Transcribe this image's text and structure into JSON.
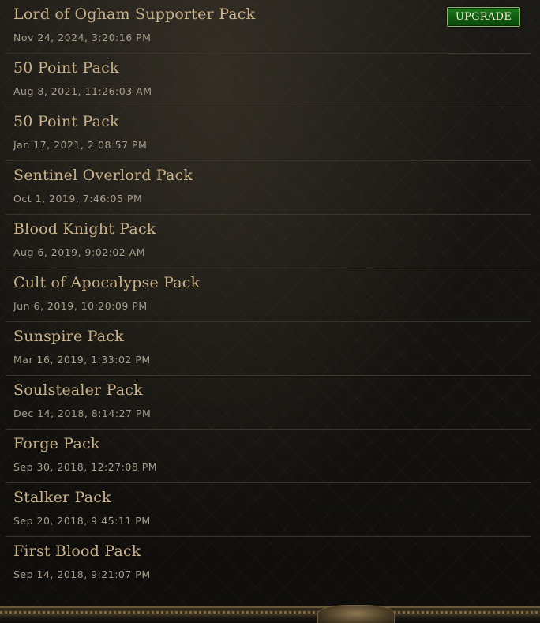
{
  "packs": [
    {
      "name": "Lord of Ogham Supporter Pack",
      "date": "Nov 24, 2024, 3:20:16 PM"
    },
    {
      "name": "50 Point Pack",
      "date": "Aug 8, 2021, 11:26:03 AM"
    },
    {
      "name": "50 Point Pack",
      "date": "Jan 17, 2021, 2:08:57 PM"
    },
    {
      "name": "Sentinel Overlord Pack",
      "date": "Oct 1, 2019, 7:46:05 PM"
    },
    {
      "name": "Blood Knight Pack",
      "date": "Aug 6, 2019, 9:02:02 AM"
    },
    {
      "name": "Cult of Apocalypse Pack",
      "date": "Jun 6, 2019, 10:20:09 PM"
    },
    {
      "name": "Sunspire Pack",
      "date": "Mar 16, 2019, 1:33:02 PM"
    },
    {
      "name": "Soulstealer Pack",
      "date": "Dec 14, 2018, 8:14:27 PM"
    },
    {
      "name": "Forge Pack",
      "date": "Sep 30, 2018, 12:27:08 PM"
    },
    {
      "name": "Stalker Pack",
      "date": "Sep 20, 2018, 9:45:11 PM"
    },
    {
      "name": "First Blood Pack",
      "date": "Sep 14, 2018, 9:21:07 PM"
    }
  ],
  "upgrade_button": {
    "label": "UPGRADE"
  },
  "colors": {
    "pack_name": "#c9b28a",
    "pack_date": "#a89e8e",
    "divider": "#3a352c",
    "upgrade_bg": "#0f5a10",
    "upgrade_border": "#8fb070"
  }
}
